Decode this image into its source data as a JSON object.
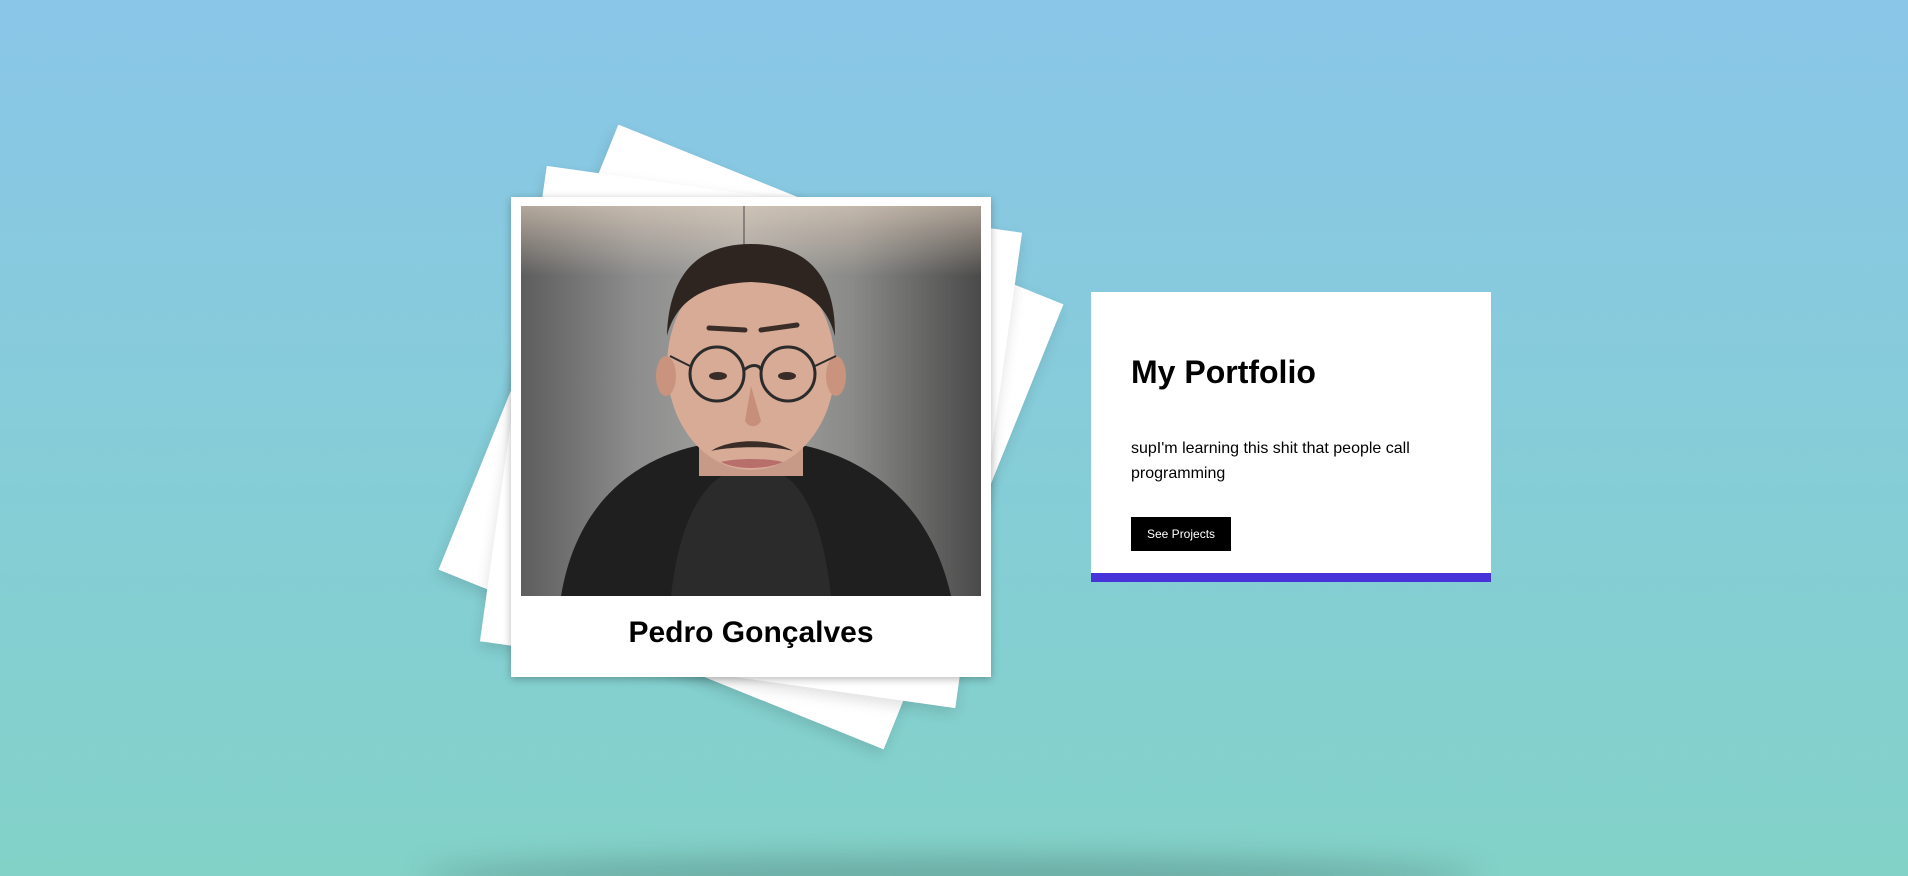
{
  "profile": {
    "name": "Pedro Gonçalves",
    "photo_alt": "portrait-photo"
  },
  "portfolio": {
    "title": "My Portfolio",
    "description": "supI'm learning this shit that people call programming",
    "button_label": "See Projects"
  },
  "colors": {
    "background_top": "#8ac6e8",
    "background_bottom": "#83d2c8",
    "accent": "#4634d8",
    "button": "#000000"
  }
}
